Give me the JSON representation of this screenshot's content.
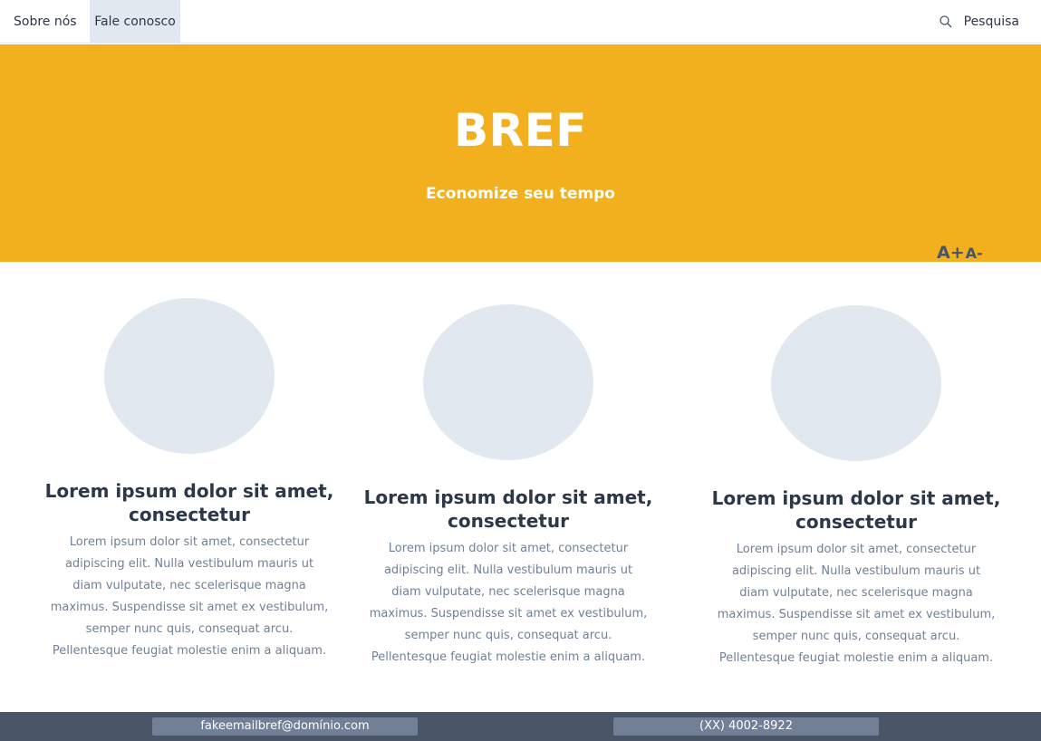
{
  "nav": {
    "links": [
      "Sobre nós",
      "Fale conosco"
    ],
    "search_label": "Pesquisa",
    "search_icon": "search-icon"
  },
  "hero": {
    "title": "BREF",
    "subtitle": "Economize seu tempo",
    "font_increase": "A+",
    "font_decrease": "A-",
    "background_color": "#f2b01e"
  },
  "cards": [
    {
      "title": "Lorem ipsum dolor sit amet, consectetur",
      "text": "Lorem ipsum dolor sit amet, consectetur adipiscing elit. Nulla vestibulum mauris ut diam vulputate, nec scelerisque magna maximus. Suspendisse sit amet ex vestibulum, semper nunc quis, consequat arcu. Pellentesque feugiat molestie enim a aliquam."
    },
    {
      "title": "Lorem ipsum dolor sit amet, consectetur",
      "text": "Lorem ipsum dolor sit amet, consectetur adipiscing elit. Nulla vestibulum mauris ut diam vulputate, nec scelerisque magna maximus. Suspendisse sit amet ex vestibulum, semper nunc quis, consequat arcu. Pellentesque feugiat molestie enim a aliquam."
    },
    {
      "title": "Lorem ipsum dolor sit amet, consectetur",
      "text": "Lorem ipsum dolor sit amet, consectetur adipiscing elit. Nulla vestibulum mauris ut diam vulputate, nec scelerisque magna maximus. Suspendisse sit amet ex vestibulum, semper nunc quis, consequat arcu. Pellentesque feugiat molestie enim a aliquam."
    }
  ],
  "footer": {
    "email": "fakeemailbref@domínio.com",
    "phone": "(XX) 4002-8922"
  }
}
